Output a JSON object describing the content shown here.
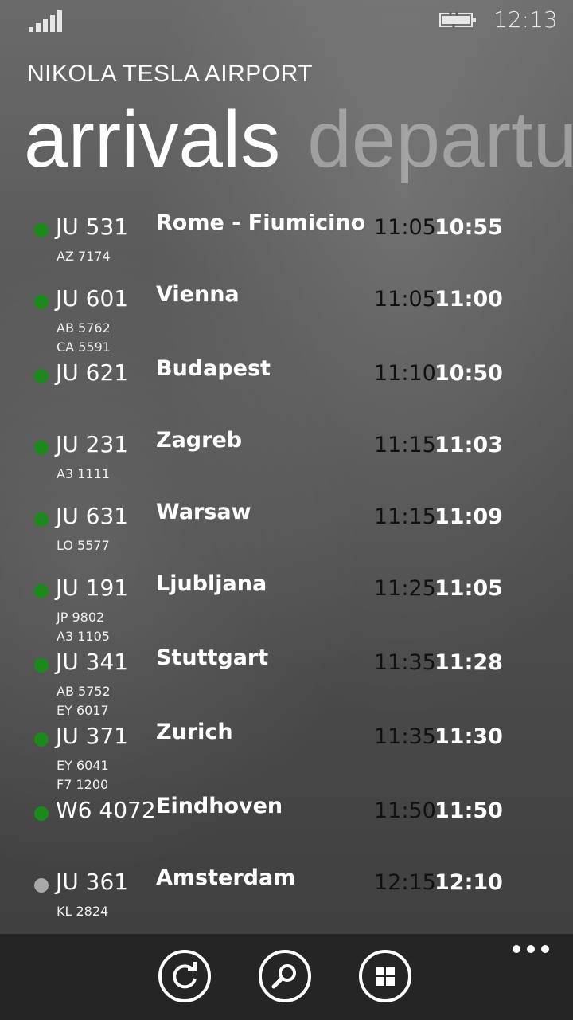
{
  "status_bar": {
    "time": "12:13"
  },
  "header": {
    "app_title": "NIKOLA TESLA AIRPORT",
    "pivots": [
      {
        "label": "arrivals",
        "active": true
      },
      {
        "label": "departures",
        "active": false
      }
    ]
  },
  "flights": [
    {
      "flight": "JU 531",
      "codeshares": [
        "AZ 7174"
      ],
      "city": "Rome - Fiumicino",
      "scheduled": "11:05",
      "actual": "10:55",
      "status": "landed"
    },
    {
      "flight": "JU 601",
      "codeshares": [
        "AB 5762",
        "CA 5591"
      ],
      "city": "Vienna",
      "scheduled": "11:05",
      "actual": "11:00",
      "status": "landed"
    },
    {
      "flight": "JU 621",
      "codeshares": [],
      "city": "Budapest",
      "scheduled": "11:10",
      "actual": "10:50",
      "status": "landed"
    },
    {
      "flight": "JU 231",
      "codeshares": [
        "A3 1111"
      ],
      "city": "Zagreb",
      "scheduled": "11:15",
      "actual": "11:03",
      "status": "landed"
    },
    {
      "flight": "JU 631",
      "codeshares": [
        "LO 5577"
      ],
      "city": "Warsaw",
      "scheduled": "11:15",
      "actual": "11:09",
      "status": "landed"
    },
    {
      "flight": "JU 191",
      "codeshares": [
        "JP 9802",
        "A3 1105"
      ],
      "city": "Ljubljana",
      "scheduled": "11:25",
      "actual": "11:05",
      "status": "landed"
    },
    {
      "flight": "JU 341",
      "codeshares": [
        "AB 5752",
        "EY 6017"
      ],
      "city": "Stuttgart",
      "scheduled": "11:35",
      "actual": "11:28",
      "status": "landed"
    },
    {
      "flight": "JU 371",
      "codeshares": [
        "EY 6041",
        "F7 1200"
      ],
      "city": "Zurich",
      "scheduled": "11:35",
      "actual": "11:30",
      "status": "landed"
    },
    {
      "flight": "W6 4072",
      "codeshares": [],
      "city": "Eindhoven",
      "scheduled": "11:50",
      "actual": "11:50",
      "status": "landed"
    },
    {
      "flight": "JU 361",
      "codeshares": [
        "KL 2824"
      ],
      "city": "Amsterdam",
      "scheduled": "12:15",
      "actual": "12:10",
      "status": "expected"
    }
  ],
  "status_colors": {
    "landed": "#1a8a1a",
    "expected": "#a8a8a8"
  },
  "app_bar": {
    "buttons": [
      {
        "icon": "refresh-icon"
      },
      {
        "icon": "search-icon"
      },
      {
        "icon": "tiles-icon"
      }
    ],
    "more_icon": "ellipsis-icon"
  }
}
